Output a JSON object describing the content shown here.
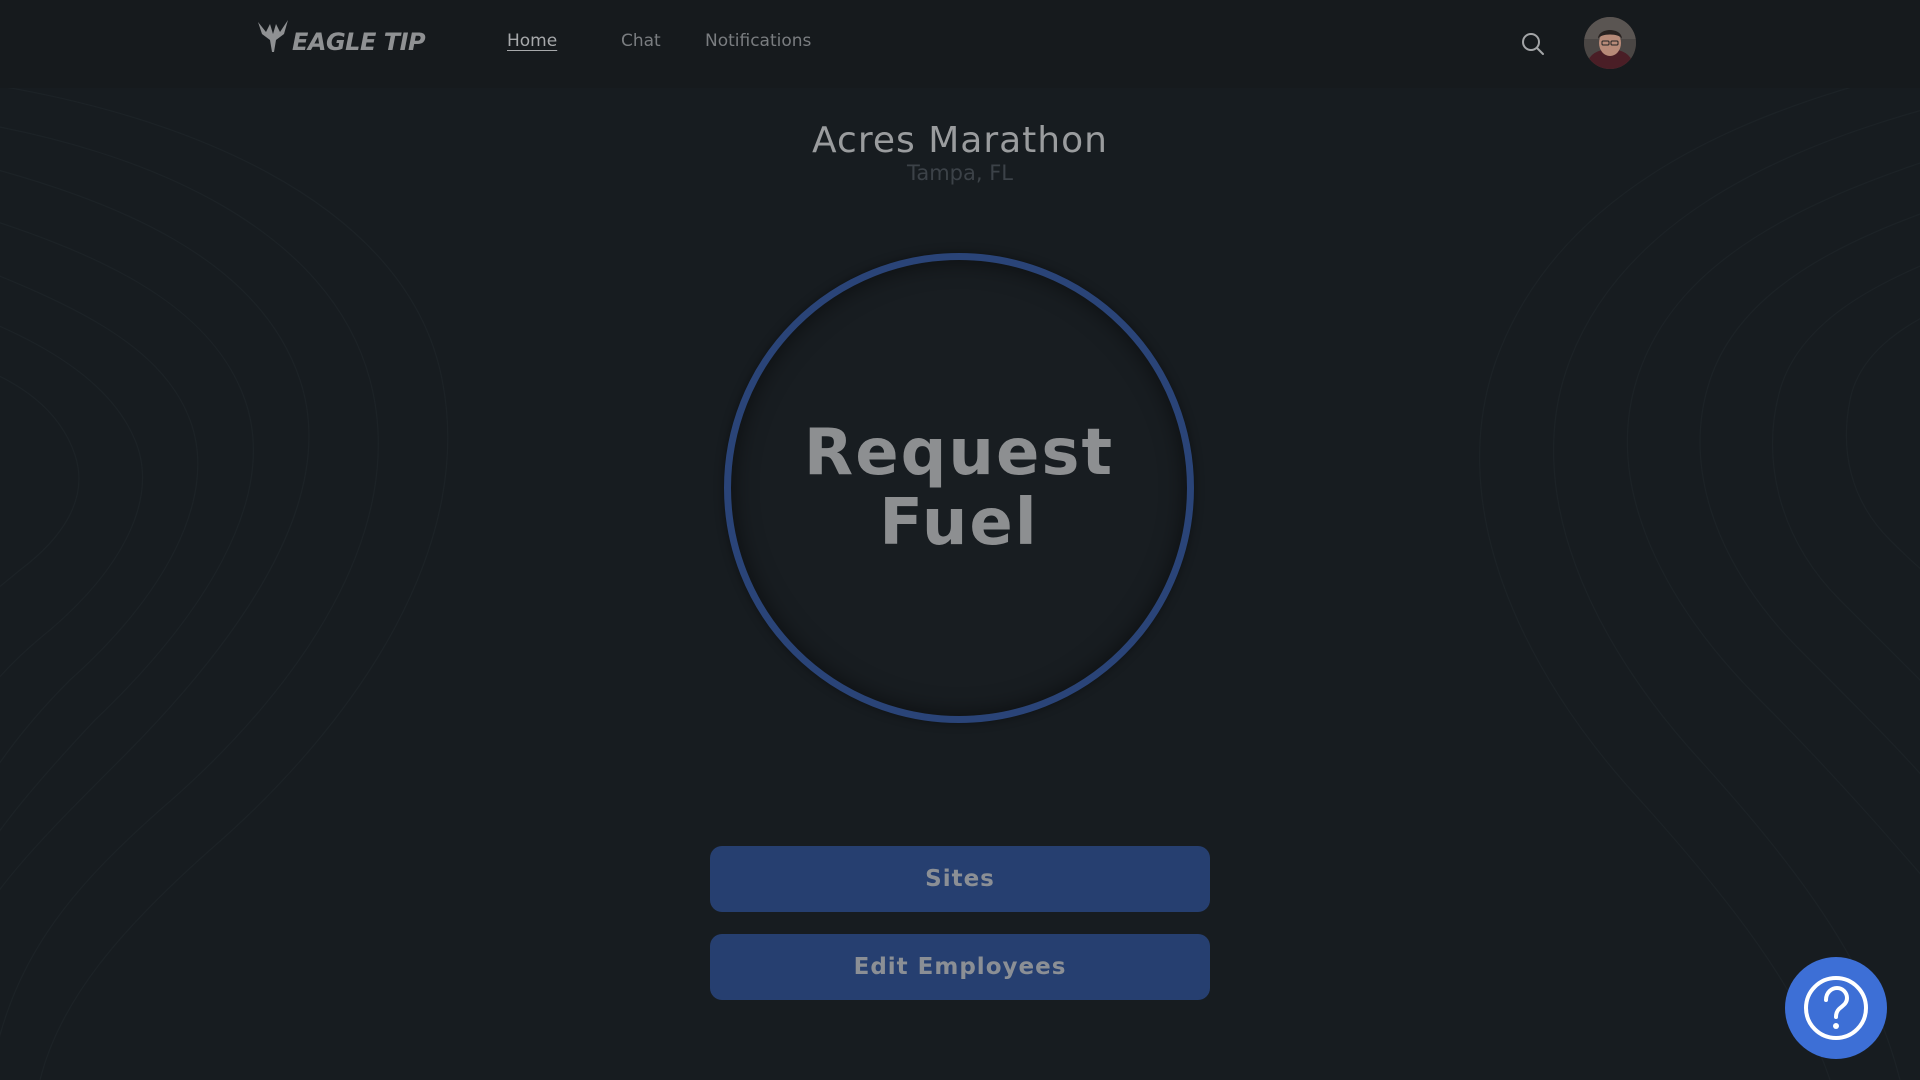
{
  "brand": {
    "logo_text": "EAGLE TIP"
  },
  "nav": {
    "items": [
      {
        "label": "Home",
        "active": true
      },
      {
        "label": "Chat",
        "active": false
      },
      {
        "label": "Notifications",
        "active": false
      }
    ]
  },
  "header": {
    "search_icon": "search-icon",
    "avatar": "user-avatar"
  },
  "site": {
    "name": "Acres Marathon",
    "location": "Tampa, FL"
  },
  "main": {
    "request_label_line1": "Request",
    "request_label_line2": "Fuel",
    "buttons": {
      "sites": "Sites",
      "edit_employees": "Edit Employees"
    }
  },
  "help": {
    "icon": "question-icon"
  },
  "colors": {
    "background": "#171c20",
    "accent": "#2a4478",
    "button": "#263f70",
    "help": "#3d6fd6"
  }
}
